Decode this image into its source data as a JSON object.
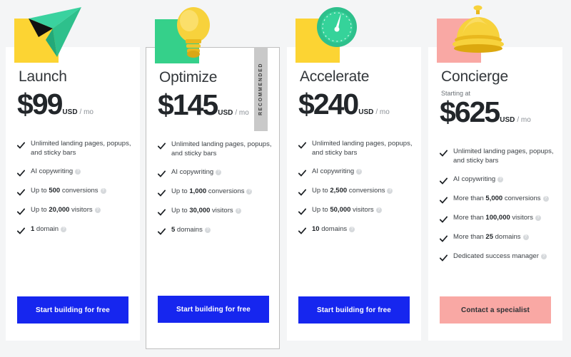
{
  "page": {
    "background_color": "#f4f5f6",
    "card_background": "#ffffff"
  },
  "colors": {
    "accent_blue": "#1626ef",
    "accent_pink": "#f9a8a4",
    "square_yellow": "#fcd433",
    "square_green": "#35d08a",
    "square_pink": "#f9a8a4",
    "icon_green": "#35d08a",
    "icon_yellow": "#f5c518",
    "ribbon_gray": "#c9c9c9",
    "text_dark": "#22262a",
    "text_muted": "#8b9096"
  },
  "info_icon_glyph": "?",
  "plans": [
    {
      "name": "Launch",
      "starting_at": "",
      "currency_symbol": "$",
      "price": "99",
      "currency": "USD",
      "period": "/ mo",
      "icon_name": "paper-plane-icon",
      "square_color": "#fcd433",
      "recommended": false,
      "badge_label": "",
      "features": [
        {
          "text": "Unlimited landing pages, popups, and sticky bars",
          "info": false
        },
        {
          "text": "AI copywriting",
          "info": true
        },
        {
          "text": "Up to 500 conversions",
          "info": true
        },
        {
          "text": "Up to 20,000 visitors",
          "info": true
        },
        {
          "text": "1 domain",
          "info": true
        }
      ],
      "cta_label": "Start building for free",
      "cta_style": "blue"
    },
    {
      "name": "Optimize",
      "starting_at": "",
      "currency_symbol": "$",
      "price": "145",
      "currency": "USD",
      "period": "/ mo",
      "icon_name": "lightbulb-icon",
      "square_color": "#35d08a",
      "recommended": true,
      "badge_label": "RECOMMENDED",
      "features": [
        {
          "text": "Unlimited landing pages, popups, and sticky bars",
          "info": false
        },
        {
          "text": "AI copywriting",
          "info": true
        },
        {
          "text": "Up to 1,000 conversions",
          "info": true
        },
        {
          "text": "Up to 30,000 visitors",
          "info": true
        },
        {
          "text": "5 domains",
          "info": true
        }
      ],
      "cta_label": "Start building for free",
      "cta_style": "blue"
    },
    {
      "name": "Accelerate",
      "starting_at": "",
      "currency_symbol": "$",
      "price": "240",
      "currency": "USD",
      "period": "/ mo",
      "icon_name": "speedometer-icon",
      "square_color": "#fcd433",
      "recommended": false,
      "badge_label": "",
      "features": [
        {
          "text": "Unlimited landing pages, popups, and sticky bars",
          "info": false
        },
        {
          "text": "AI copywriting",
          "info": true
        },
        {
          "text": "Up to 2,500 conversions",
          "info": true
        },
        {
          "text": "Up to 50,000 visitors",
          "info": true
        },
        {
          "text": "10 domains",
          "info": true
        }
      ],
      "cta_label": "Start building for free",
      "cta_style": "blue"
    },
    {
      "name": "Concierge",
      "starting_at": "Starting at",
      "currency_symbol": "$",
      "price": "625",
      "currency": "USD",
      "period": "/ mo",
      "icon_name": "service-bell-icon",
      "square_color": "#f9a8a4",
      "recommended": false,
      "badge_label": "",
      "features": [
        {
          "text": "Unlimited landing pages, popups, and sticky bars",
          "info": false
        },
        {
          "text": "AI copywriting",
          "info": true
        },
        {
          "text": "More than 5,000 conversions",
          "info": true
        },
        {
          "text": "More than 100,000 visitors",
          "info": true
        },
        {
          "text": "More than 25 domains",
          "info": true
        },
        {
          "text": "Dedicated success manager",
          "info": true
        }
      ],
      "cta_label": "Contact a specialist",
      "cta_style": "pink"
    }
  ]
}
